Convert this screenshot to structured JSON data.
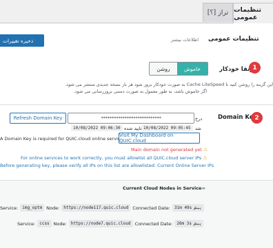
{
  "tabs": [
    {
      "label": "تنظیمات عمومی",
      "active": true
    },
    {
      "label": "[؟] تراز",
      "active": false
    }
  ],
  "header": {
    "title": "تنظیمات عمومی",
    "subtitle": "اطلاعات بیشتر",
    "save_button": "ذخیره تغییرات"
  },
  "auto_upgrade": {
    "number": "1",
    "label": "ارتقا خودکار",
    "toggle_on": "روشن",
    "toggle_off": "خاموش",
    "selected": "خاموش",
    "description_line1": "این گزینه را روشن کنید تا Cache LiteSpeed به صورت خودکار بروز شود هر بار نسخه جدیدی منتشر می شود.",
    "description_line2": "اگر خاموش باشد، به طور معمول به صورت دستی بروزرسانی می شود."
  },
  "domain_key": {
    "number": "2",
    "label": "Domain Key",
    "value": "****************************",
    "refresh_button": "Refresh Domain Key",
    "status_prefix": "درخ",
    "stamp_label": "شد",
    "stamp_1": "10/08/2022 09:06:30",
    "stamp_mid": "تایید شده",
    "stamp_2": "10/08/2022 09:05:45",
    "required_note": "A Domain Key is required for QUIC.cloud online services.",
    "dashboard_button": "Visit My Dashboard on QUIC.cloud",
    "main_domain_warning": "Main domain not generated yet",
    "allowlist_note": "For online services to work correctly, you must allowlist all QUIC.cloud server IPs",
    "verify_note": "Before generating key, please verify all IPs on this list are allowlisted:",
    "verify_link": "Current Online Server IPs"
  },
  "cloud_nodes": {
    "title": "Current Cloud Nodes in Service",
    "rows": [
      {
        "service_label": "Service:",
        "service": "img_optm",
        "node_label": "Node:",
        "node": "https://node117.quic.cloud",
        "date_label": "Connected Date:",
        "age": "31m 49s پیش"
      },
      {
        "service_label": "Service:",
        "service": "ccss",
        "node_label": "Node:",
        "node": "https://node7.quic.cloud",
        "date_label": "Connected Date:",
        "age": "26m 3s پیش"
      }
    ]
  },
  "colors": {
    "accent": "#2271b1",
    "toggle_on": "#36b0a9",
    "badge": "#e0393e",
    "warning": "#dba617"
  }
}
